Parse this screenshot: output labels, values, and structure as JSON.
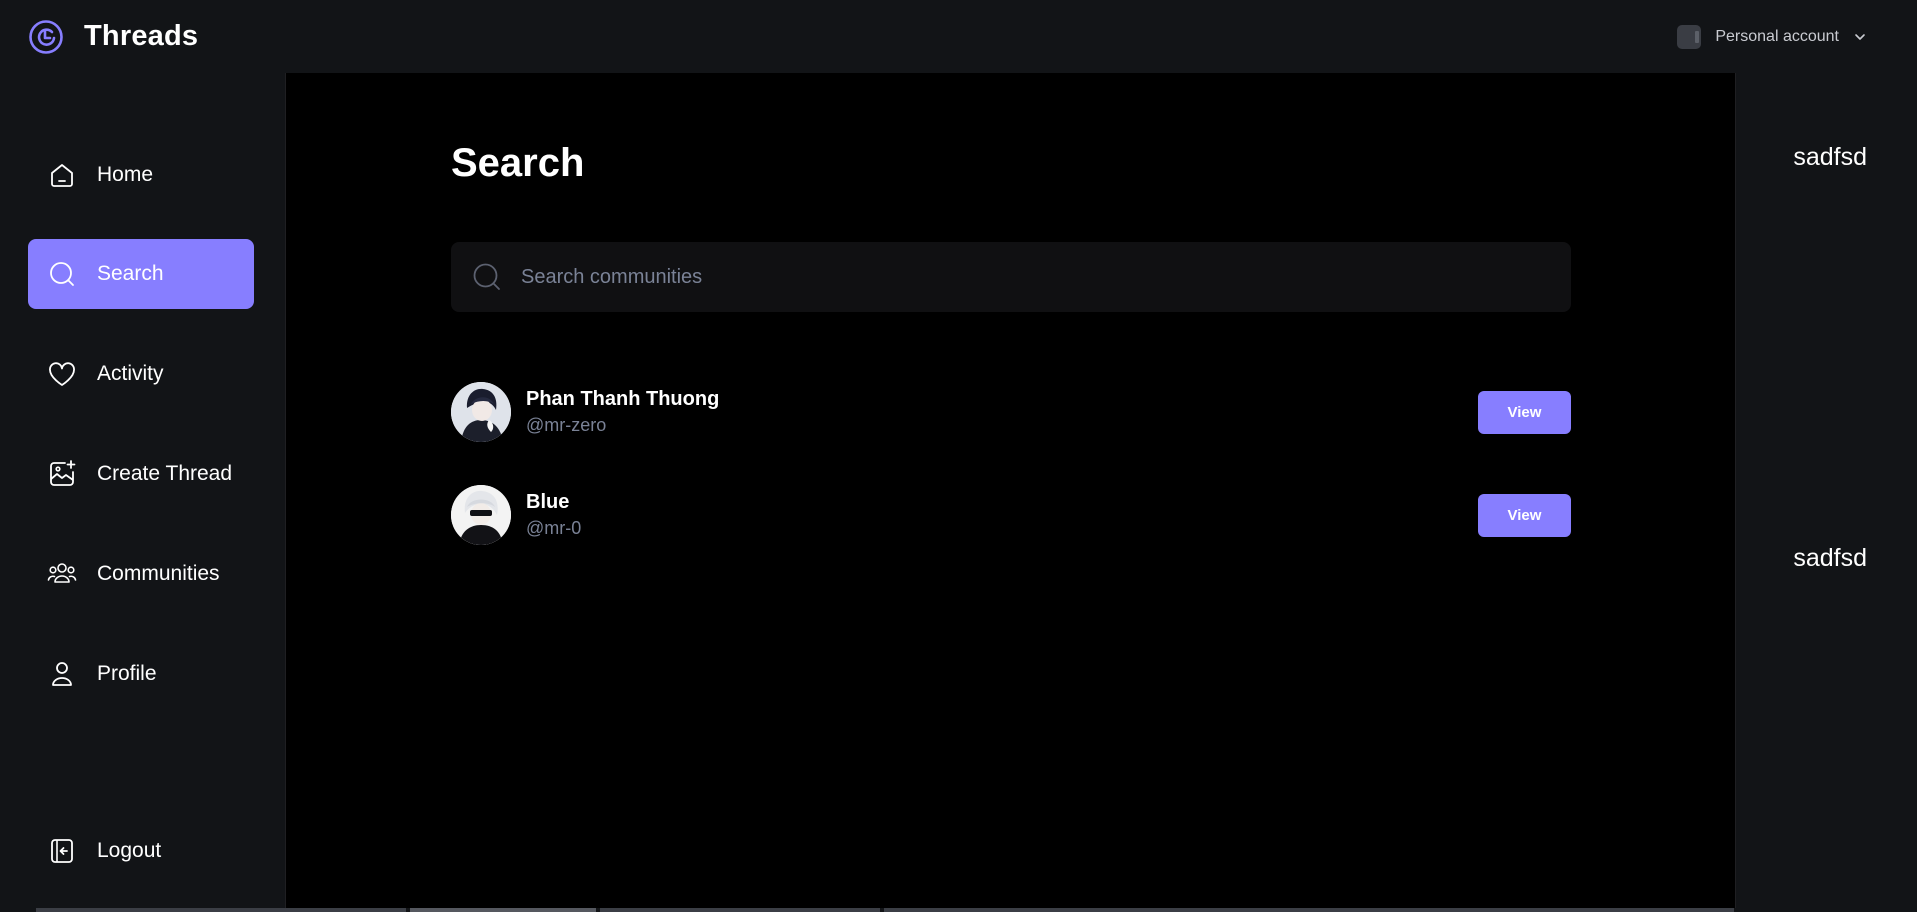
{
  "app": {
    "name": "Threads",
    "account_label": "Personal account"
  },
  "sidebar": {
    "items": [
      {
        "label": "Home",
        "icon": "home-icon",
        "active": false
      },
      {
        "label": "Search",
        "icon": "search-icon",
        "active": true
      },
      {
        "label": "Activity",
        "icon": "heart-icon",
        "active": false
      },
      {
        "label": "Create Thread",
        "icon": "image-plus-icon",
        "active": false
      },
      {
        "label": "Communities",
        "icon": "users-icon",
        "active": false
      },
      {
        "label": "Profile",
        "icon": "user-icon",
        "active": false
      }
    ],
    "logout_label": "Logout"
  },
  "main": {
    "title": "Search",
    "search": {
      "placeholder": "Search communities",
      "value": ""
    },
    "results": [
      {
        "name": "Phan Thanh Thuong",
        "handle": "@mr-zero",
        "button_label": "View"
      },
      {
        "name": "Blue",
        "handle": "@mr-0",
        "button_label": "View"
      }
    ]
  },
  "rightbar": {
    "top_text": "sadfsd",
    "bottom_text": "sadfsd"
  },
  "colors": {
    "accent": "#877eff",
    "background": "#121417",
    "main_background": "#000000",
    "muted_text": "#7a8296"
  }
}
